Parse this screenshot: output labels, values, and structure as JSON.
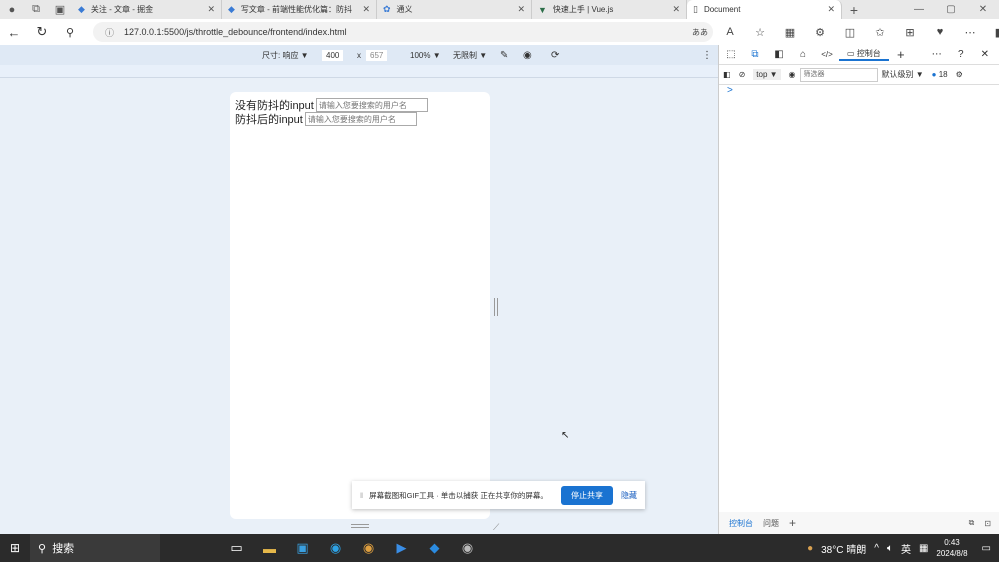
{
  "browser": {
    "tabs": [
      {
        "title": "关注 - 文章 - 掘金",
        "active": false
      },
      {
        "title": "写文章 - 前端性能优化篇：防抖",
        "active": false
      },
      {
        "title": "通义",
        "active": false
      },
      {
        "title": "快速上手 | Vue.js",
        "active": false
      },
      {
        "title": "Document",
        "active": true
      }
    ],
    "url": "127.0.0.1:5500/js/throttle_debounce/frontend/index.html"
  },
  "device_toolbar": {
    "size_label": "尺寸: 响应",
    "width": "400",
    "times": "x",
    "height": "657",
    "zoom": "100%",
    "throttle": "无限制"
  },
  "page": {
    "rows": [
      {
        "label": "没有防抖的input",
        "placeholder": "请输入您要搜索的用户名"
      },
      {
        "label": "防抖后的input",
        "placeholder": "请输入您要搜索的用户名"
      }
    ]
  },
  "toast": {
    "text": "屏幕截图和GIF工具 · 单击以捕获 正在共享你的屏幕。",
    "stop": "停止共享",
    "hide": "隐藏"
  },
  "devtools": {
    "console_tab": "控制台",
    "context": "top",
    "filter_placeholder": "筛选器",
    "level": "默认级别",
    "issues_count": "18",
    "prompt": ">",
    "bottom_tabs": [
      "控制台",
      "问题"
    ]
  },
  "taskbar": {
    "search": "搜索",
    "weather": "38°C 晴朗",
    "ime": "英",
    "time": "0:43",
    "date": "2024/8/8"
  }
}
